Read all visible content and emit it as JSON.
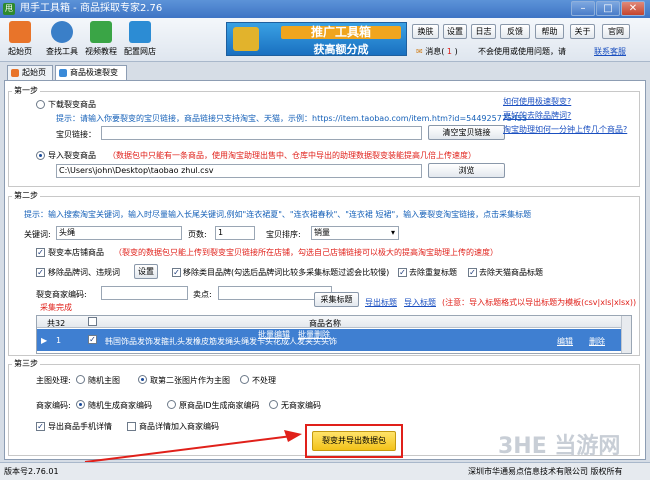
{
  "titlebar": {
    "title": "甩手工具箱 - 商品採取专家2.76",
    "app_icon": "甩"
  },
  "toolbar": {
    "items": [
      {
        "label": "起始页",
        "icon": "home-icon",
        "color": "#e8742a"
      },
      {
        "label": "查找工具",
        "icon": "search-icon",
        "color": "#3a7fc8"
      },
      {
        "label": "视频教程",
        "icon": "video-icon",
        "color": "#3aa546"
      },
      {
        "label": "配置网店",
        "icon": "store-icon",
        "color": "#2c8cd4"
      }
    ],
    "banner": {
      "line1": "推广工具箱",
      "line2": "获高额分成"
    },
    "top_buttons": [
      "换肤",
      "设置",
      "日志",
      "反馈",
      "帮助",
      "关于",
      "官网"
    ],
    "message_label": "消息(",
    "message_count": "1",
    "message_close": ")",
    "hint_text": "不会使用或使用问题，请",
    "support_link": "联系客服"
  },
  "tabs": [
    {
      "label": "起始页"
    },
    {
      "label": "商品极速裂变"
    }
  ],
  "step1": {
    "legend": "第一步",
    "download_label": "下载裂变商品",
    "tip": "提示：请输入你要裂变的宝贝链接，商品链接只支持淘宝、天猫，示例：https://item.taobao.com/item.htm?id=544925775455",
    "link_url_label": "宝贝链接：",
    "link_url_value": "",
    "clear_button": "清空宝贝链接",
    "import_label": "导入裂变商品",
    "import_note": "（数据包中只能有一条商品，使用淘宝助理出售中、仓库中导出的助理数据裂变装能提高几倍上传速度）",
    "path_value": "C:\\Users\\john\\Desktop\\taobao zhul.csv",
    "browse_button": "浏览",
    "help_links": [
      "如何使用极速裂变?",
      "更好的去除品牌词?",
      "淘宝助理如何一分钟上传几个商品?"
    ]
  },
  "step2": {
    "legend": "第二步",
    "tip": "提示：输入搜索淘宝关键词，输入时尽量输入长尾关键词,例如\"连衣裙夏\"、\"连衣裙春秋\"、\"连衣裙 短裙\"，输入要裂变淘宝链接，点击采集标题",
    "keyword_label": "关键词:",
    "keyword_value": "头绳",
    "pages_label": "页数:",
    "pages_value": "1",
    "sort_label": "宝贝排序:",
    "sort_value": "销量",
    "split_store_label": "裂变本店铺商品",
    "split_store_note": "（裂变的数据包只能上传到裂变宝贝链接所在店铺，勾选自己店铺链接可以极大的提高淘宝助理上传的速度）",
    "remove_brand_label": "移除品牌词、违规词",
    "settings_button": "设置",
    "remove_category_label": "移除类目品牌(勾选后品牌词比较多采集标题过滤会比较慢)",
    "dedupe_label": "去除重复标题",
    "remove_tmall_label": "去除天猫商品标题",
    "merchant_code_label": "裂变商家编码:",
    "merchant_code_value": "",
    "selling_point_label": "卖点:",
    "selling_point_value": "",
    "collect_button": "采集标题",
    "collect_done": "采集完成",
    "export_titles": "导出标题",
    "import_titles": "导入标题",
    "note": "(注意：导入标题格式以导出标题为模板(csv|xls|xlsx))",
    "grid": {
      "header_count": "共32",
      "header_name": "商品名称",
      "rows": [
        {
          "num": "1",
          "name": "韩国饰品发饰发箍扎头发橡皮筋发绳头绳发卡头花成人发夹头头饰",
          "edit": "编辑",
          "delete": "删除"
        }
      ],
      "batch_edit": "批量编辑",
      "batch_delete": "批量删除"
    }
  },
  "step3": {
    "legend": "第三步",
    "main_image_label": "主图处理:",
    "main_image_options": [
      "随机主图",
      "取第二张图片作为主图",
      "不处理"
    ],
    "merchant_label": "商家编码:",
    "merchant_options": [
      "随机生成商家编码",
      "原商品ID生成商家编码",
      "无商家编码"
    ],
    "export_mobile_label": "导出商品手机详情",
    "add_merchant_label": "商品详情加入商家编码",
    "export_button": "裂变并导出数据包"
  },
  "statusbar": {
    "version": "版本号2.76.01",
    "company": "深圳市华通易点信息技术有限公司 版权所有"
  },
  "watermark": "3HE 当游网"
}
